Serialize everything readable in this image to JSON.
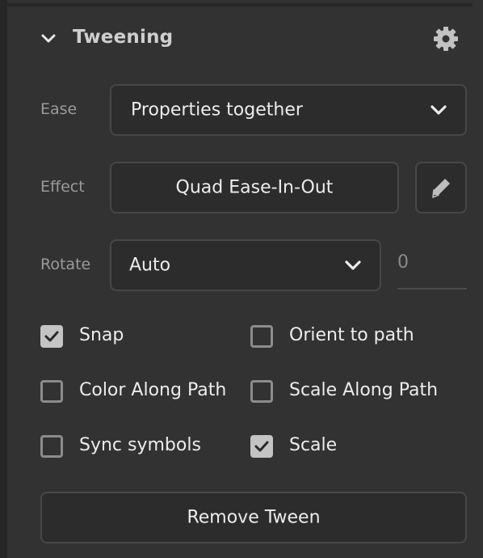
{
  "section": {
    "title": "Tweening",
    "expanded": true,
    "icons": {
      "collapse": "chevron-down-icon",
      "settings": "gear-icon"
    }
  },
  "ease": {
    "label": "Ease",
    "value": "Properties together"
  },
  "effect": {
    "label": "Effect",
    "value": "Quad Ease-In-Out",
    "edit_icon": "pencil-icon"
  },
  "rotate": {
    "label": "Rotate",
    "value": "Auto",
    "count": "0"
  },
  "options": [
    {
      "label": "Snap",
      "checked": true
    },
    {
      "label": "Orient to path",
      "checked": false
    },
    {
      "label": "Color Along Path",
      "checked": false
    },
    {
      "label": "Scale Along Path",
      "checked": false
    },
    {
      "label": "Sync symbols",
      "checked": false
    },
    {
      "label": "Scale",
      "checked": true
    }
  ],
  "actions": {
    "remove_label": "Remove Tween"
  },
  "colors": {
    "panel_bg": "#323232",
    "field_bg": "#2c2c2c",
    "border": "#474747",
    "text": "#ececec",
    "label": "#9a9a9a",
    "checkbox_on": "#c4c4c4"
  }
}
